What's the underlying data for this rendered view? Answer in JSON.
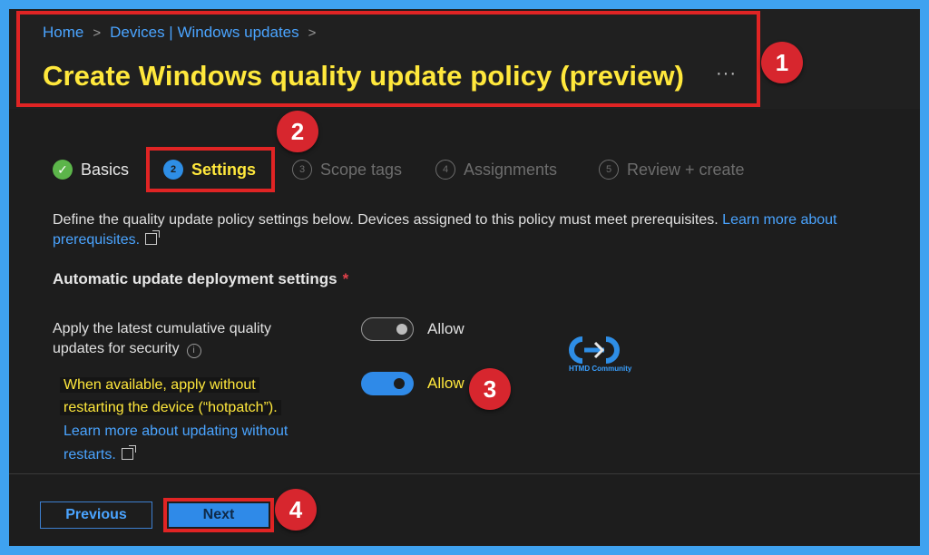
{
  "breadcrumb": [
    "Home",
    "Devices | Windows updates"
  ],
  "page_title": "Create Windows quality update policy (preview)",
  "more_label": "···",
  "steps": [
    {
      "number": "✓",
      "label": "Basics",
      "state": "done"
    },
    {
      "number": "2",
      "label": "Settings",
      "state": "active"
    },
    {
      "number": "3",
      "label": "Scope tags",
      "state": "pending"
    },
    {
      "number": "4",
      "label": "Assignments",
      "state": "pending"
    },
    {
      "number": "5",
      "label": "Review + create",
      "state": "pending"
    }
  ],
  "description": {
    "text": "Define the quality update policy settings below. Devices assigned to this policy must meet prerequisites. ",
    "link_part1": "Learn more about",
    "link_part2": "prerequisites."
  },
  "section": {
    "title": "Automatic update deployment settings",
    "required_mark": "*"
  },
  "settings": {
    "security": {
      "label_line1": "Apply the latest cumulative quality",
      "label_line2": "updates for security",
      "toggle_state": "off",
      "toggle_label": "Allow"
    },
    "hotpatch": {
      "label_line1": "When available, apply without",
      "label_line2": "restarting the device (“hotpatch”).",
      "link_line1": "Learn more about updating without",
      "link_line2": "restarts.",
      "toggle_state": "on",
      "toggle_label": "Allow"
    }
  },
  "buttons": {
    "previous": "Previous",
    "next": "Next"
  },
  "callouts": [
    "1",
    "2",
    "3",
    "4"
  ],
  "watermark": {
    "text": "HTMD Community"
  },
  "colors": {
    "highlight": "#ffe83c",
    "annotation_red": "#e02424",
    "link": "#4aa4ff",
    "accent": "#2f8ae8",
    "background": "#1d1d1d"
  }
}
